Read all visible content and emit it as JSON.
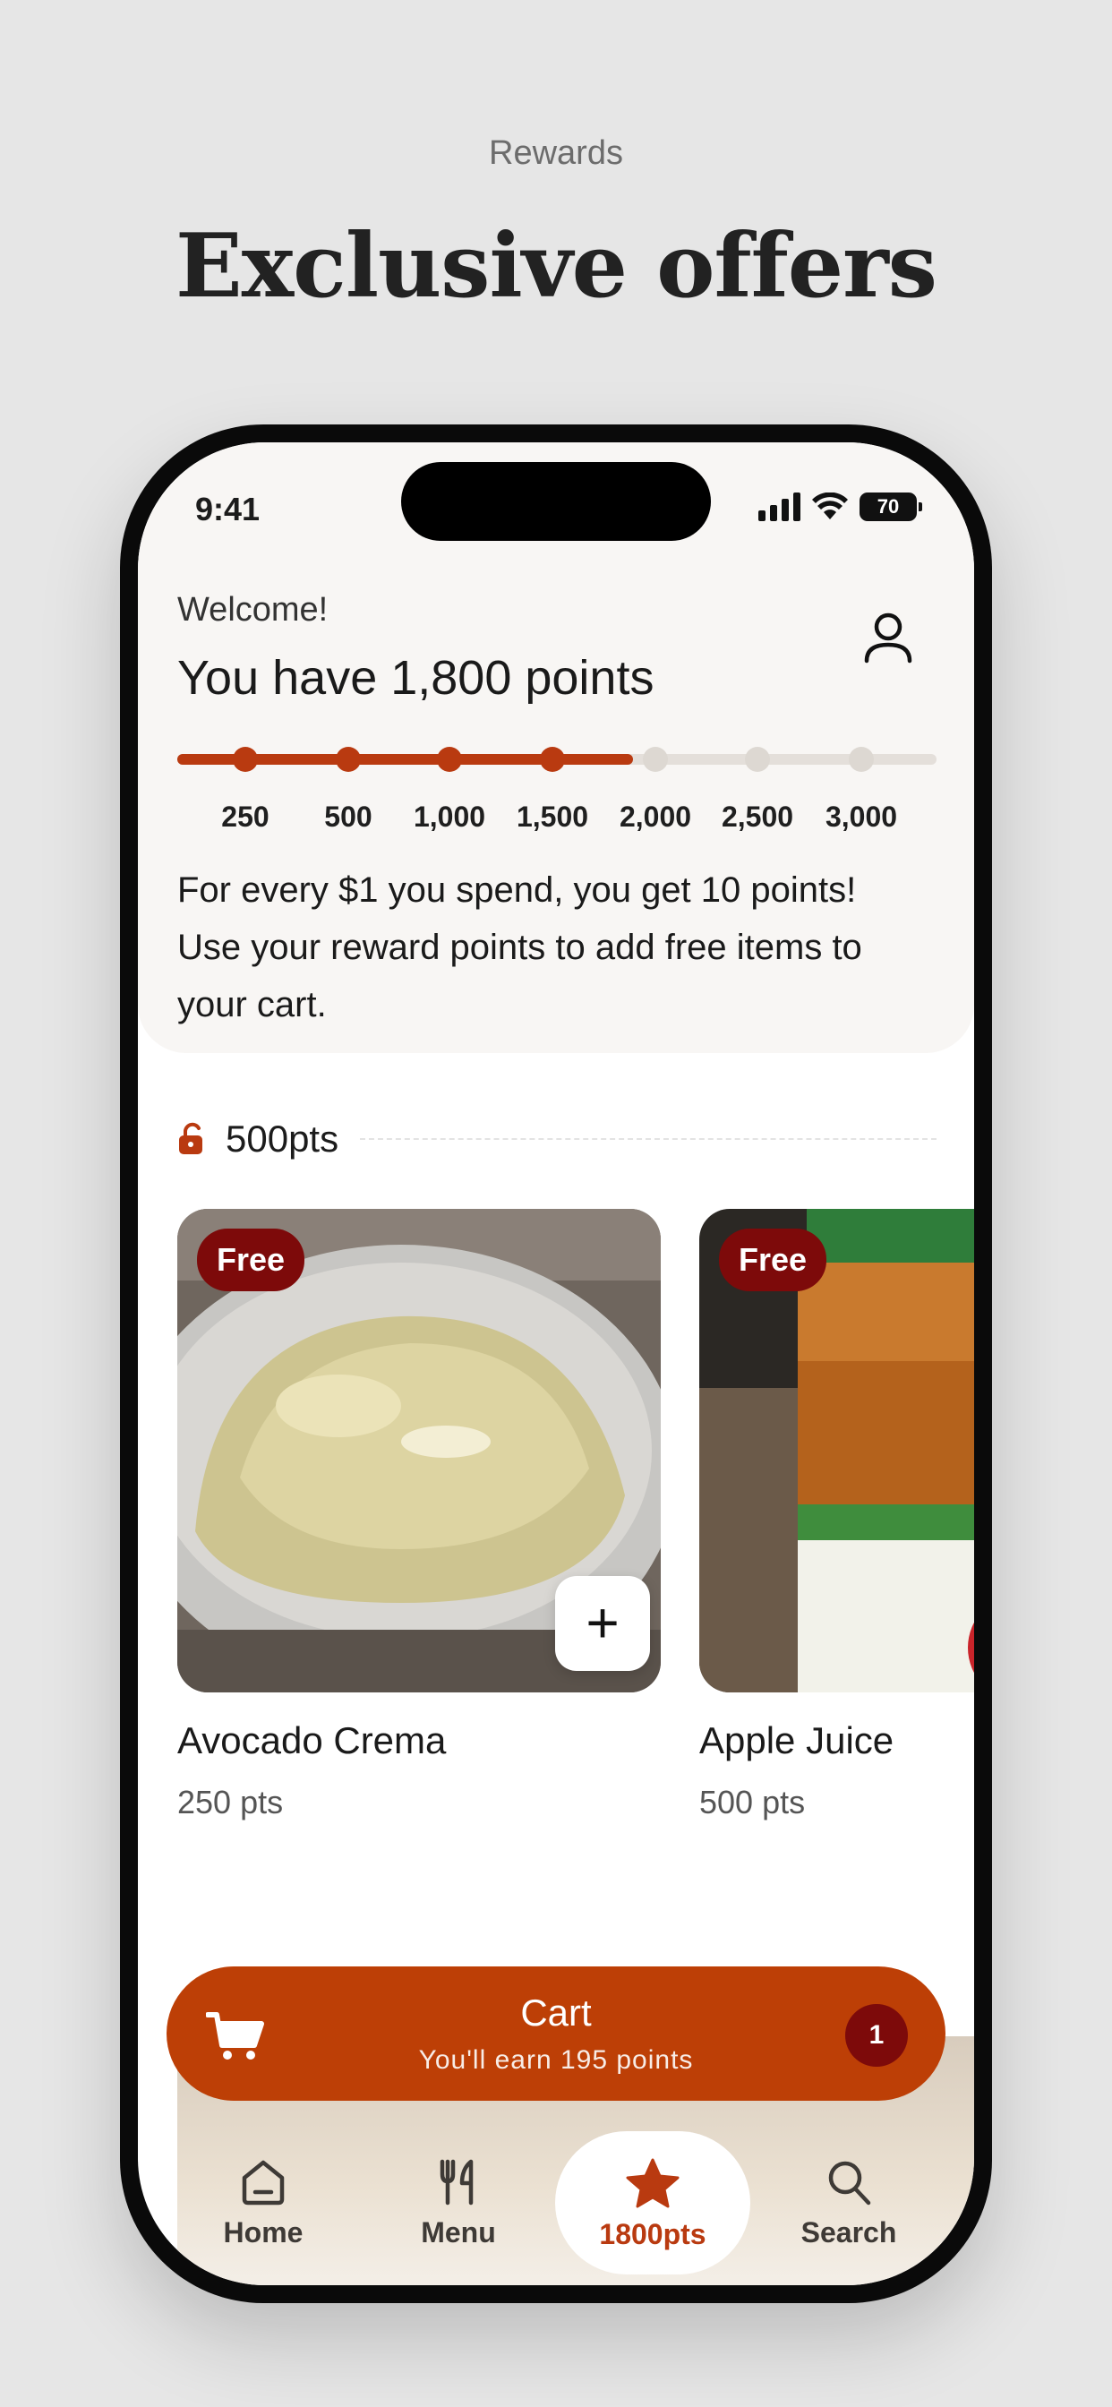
{
  "hero": {
    "eyebrow": "Rewards",
    "title": "Exclusive offers"
  },
  "status_bar": {
    "time": "9:41",
    "battery": "70"
  },
  "rewards": {
    "welcome": "Welcome!",
    "points_title": "You have 1,800 points",
    "progress_fraction": 0.6,
    "milestones": [
      {
        "label": "250",
        "reached": true
      },
      {
        "label": "500",
        "reached": true
      },
      {
        "label": "1,000",
        "reached": true
      },
      {
        "label": "1,500",
        "reached": true
      },
      {
        "label": "2,000",
        "reached": false
      },
      {
        "label": "2,500",
        "reached": false
      },
      {
        "label": "3,000",
        "reached": false
      }
    ],
    "explanation": "For every $1 you spend, you get 10 points! Use your reward points to add free items to your cart."
  },
  "tier": {
    "label": "500pts"
  },
  "items": [
    {
      "badge": "Free",
      "name": "Avocado Crema",
      "points": "250 pts",
      "add_label": "+"
    },
    {
      "badge": "Free",
      "name": "Apple Juice",
      "points": "500 pts"
    }
  ],
  "cart": {
    "title": "Cart",
    "subtitle": "You'll earn 195 points",
    "count": "1"
  },
  "tabbar": {
    "home": "Home",
    "menu": "Menu",
    "rewards": "1800pts",
    "search": "Search"
  },
  "colors": {
    "accent": "#bd3f06",
    "badge": "#7d0a0a",
    "progress": "#b93a10"
  }
}
